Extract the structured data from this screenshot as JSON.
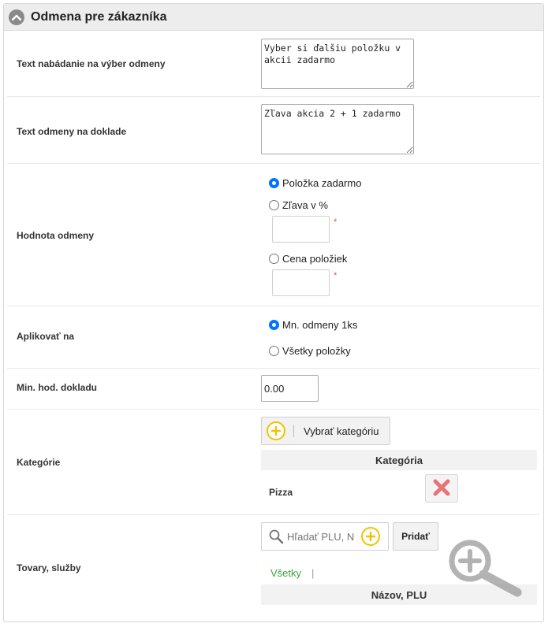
{
  "panel": {
    "title": "Odmena pre zákazníka"
  },
  "fields": {
    "prompt_text": {
      "label": "Text nabádanie na výber odmeny",
      "value": "Vyber si ďalšiu položku v akcii zadarmo"
    },
    "receipt_text": {
      "label": "Text odmeny na doklade",
      "value": "Zľava akcia 2 + 1 zadarmo"
    },
    "reward_value": {
      "label": "Hodnota odmeny",
      "options": [
        {
          "label": "Položka zadarmo",
          "selected": true
        },
        {
          "label": "Zľava v %",
          "selected": false
        },
        {
          "label": "Cena položiek",
          "selected": false
        }
      ],
      "required_mark": "*"
    },
    "apply_to": {
      "label": "Aplikovať na",
      "options": [
        {
          "label": "Mn. odmeny 1ks",
          "selected": true
        },
        {
          "label": "Všetky položky",
          "selected": false
        }
      ]
    },
    "min_receipt": {
      "label": "Min. hod. dokladu",
      "value": "0.00"
    },
    "categories": {
      "label": "Kategórie",
      "select_button": "Vybrať kategóriu",
      "column_header": "Kategória",
      "rows": [
        "Pizza"
      ]
    },
    "products": {
      "label": "Tovary, služby",
      "search_placeholder": "Hľadať PLU, N",
      "add_button": "Pridať",
      "filter_all": "Všetky",
      "separator": "|",
      "column_header": "Názov, PLU"
    }
  },
  "colors": {
    "accent_yellow": "#f2c200",
    "link_green": "#3aa53a",
    "radio_blue": "#0075ff",
    "delete_red": "#e8737a"
  },
  "icons": {
    "collapse": "chevron-up-icon",
    "add": "plus-circle-icon",
    "delete": "x-icon",
    "search": "search-icon",
    "zoom": "zoom-in-icon"
  }
}
